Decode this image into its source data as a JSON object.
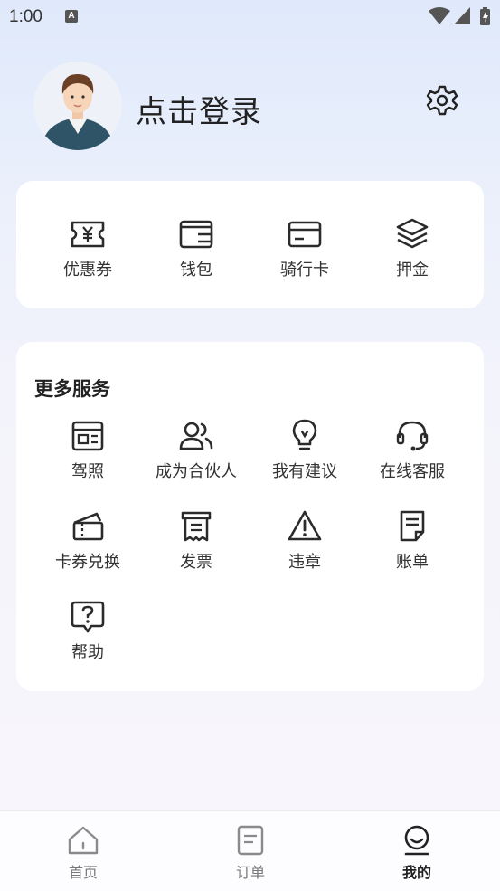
{
  "status_bar": {
    "time": "1:00"
  },
  "header": {
    "login_text": "点击登录"
  },
  "wallet_items": [
    {
      "label": "优惠券",
      "icon": "coupon-icon"
    },
    {
      "label": "钱包",
      "icon": "wallet-icon"
    },
    {
      "label": "骑行卡",
      "icon": "card-icon"
    },
    {
      "label": "押金",
      "icon": "deposit-icon"
    }
  ],
  "more_services": {
    "title": "更多服务",
    "items": [
      {
        "label": "驾照",
        "icon": "license-icon"
      },
      {
        "label": "成为合伙人",
        "icon": "partner-icon"
      },
      {
        "label": "我有建议",
        "icon": "bulb-icon"
      },
      {
        "label": "在线客服",
        "icon": "headset-icon"
      },
      {
        "label": "卡券兑换",
        "icon": "ticket-icon"
      },
      {
        "label": "发票",
        "icon": "invoice-icon"
      },
      {
        "label": "违章",
        "icon": "warning-icon"
      },
      {
        "label": "账单",
        "icon": "bill-icon"
      },
      {
        "label": "帮助",
        "icon": "help-icon"
      }
    ]
  },
  "tabbar": {
    "items": [
      {
        "label": "首页",
        "icon": "home-icon"
      },
      {
        "label": "订单",
        "icon": "order-icon"
      },
      {
        "label": "我的",
        "icon": "profile-icon",
        "active": true
      }
    ]
  },
  "colors": {
    "icon": "#2b2b2b",
    "inactive": "#888888"
  }
}
